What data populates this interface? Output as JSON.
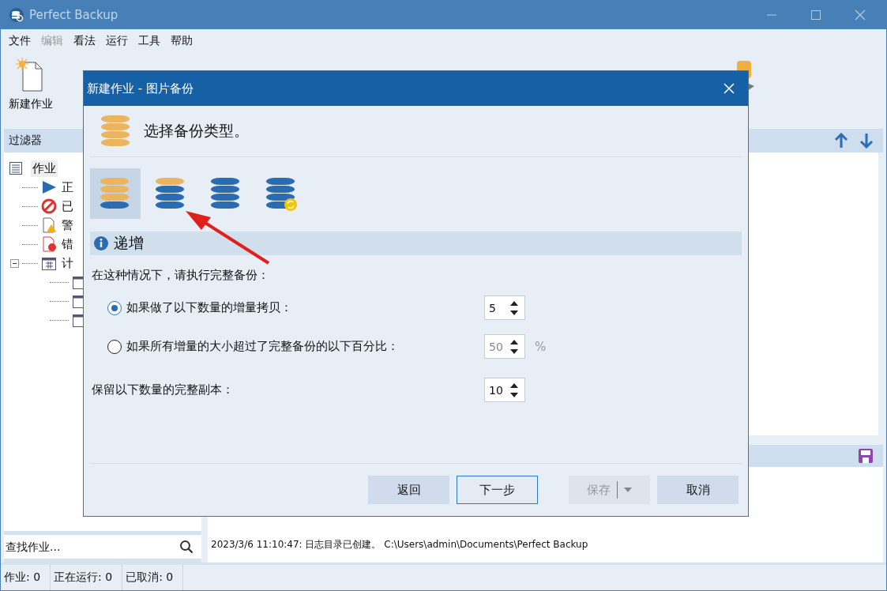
{
  "window": {
    "title": "Perfect Backup"
  },
  "menu": [
    {
      "label": "文件",
      "disabled": false
    },
    {
      "label": "编辑",
      "disabled": true
    },
    {
      "label": "看法",
      "disabled": false
    },
    {
      "label": "运行",
      "disabled": false
    },
    {
      "label": "工具",
      "disabled": false
    },
    {
      "label": "帮助",
      "disabled": false
    }
  ],
  "toolbar": [
    {
      "label": "新建作业",
      "kind": "new"
    }
  ],
  "filter_panel": {
    "title": "过滤器",
    "tree": [
      {
        "label": "作业",
        "kind": "jobs",
        "selected": true,
        "children": [
          {
            "label": "正",
            "kind": "running",
            "selected": false
          },
          {
            "label": "已",
            "kind": "cancelled",
            "selected": false
          },
          {
            "label": "警",
            "kind": "warning",
            "selected": false
          },
          {
            "label": "错",
            "kind": "error",
            "selected": false
          },
          {
            "label": "计",
            "kind": "schedule",
            "selected": false,
            "expanded": true,
            "children": [
              {
                "kind": "calendar"
              },
              {
                "kind": "calendar"
              },
              {
                "kind": "calendar"
              }
            ]
          }
        ]
      }
    ],
    "search": {
      "placeholder": "查找作业..."
    }
  },
  "log": {
    "entries": [
      "2023/3/6 11:10:47: 日志目录已创建。 C:\\Users\\admin\\Documents\\Perfect Backup"
    ]
  },
  "status_bar": [
    "作业: 0",
    "正在运行: 0",
    "已取消: 0"
  ],
  "dialog": {
    "title": "新建作业 - 图片备份",
    "heading": "选择备份类型。",
    "backup_types": [
      {
        "kind": "full",
        "selected": true
      },
      {
        "kind": "incremental",
        "selected": false
      },
      {
        "kind": "differential",
        "selected": false
      },
      {
        "kind": "sync",
        "selected": false
      }
    ],
    "section": "递增",
    "intro": "在这种情况下，请执行完整备份：",
    "options": [
      {
        "label": "如果做了以下数量的增量拷贝：",
        "selected": true,
        "value": "5",
        "disabled": false
      },
      {
        "label": "如果所有增量的大小超过了完整备份的以下百分比：",
        "selected": false,
        "value": "50",
        "disabled": true,
        "unit": "%"
      }
    ],
    "keep": {
      "label": "保留以下数量的完整副本：",
      "value": "10"
    },
    "buttons": [
      {
        "label": "返回",
        "kind": "plain",
        "disabled": false
      },
      {
        "label": "下一步",
        "kind": "default",
        "disabled": false
      },
      {
        "label": "保存",
        "kind": "split",
        "disabled": true
      },
      {
        "label": "取消",
        "kind": "plain",
        "disabled": false
      }
    ]
  }
}
